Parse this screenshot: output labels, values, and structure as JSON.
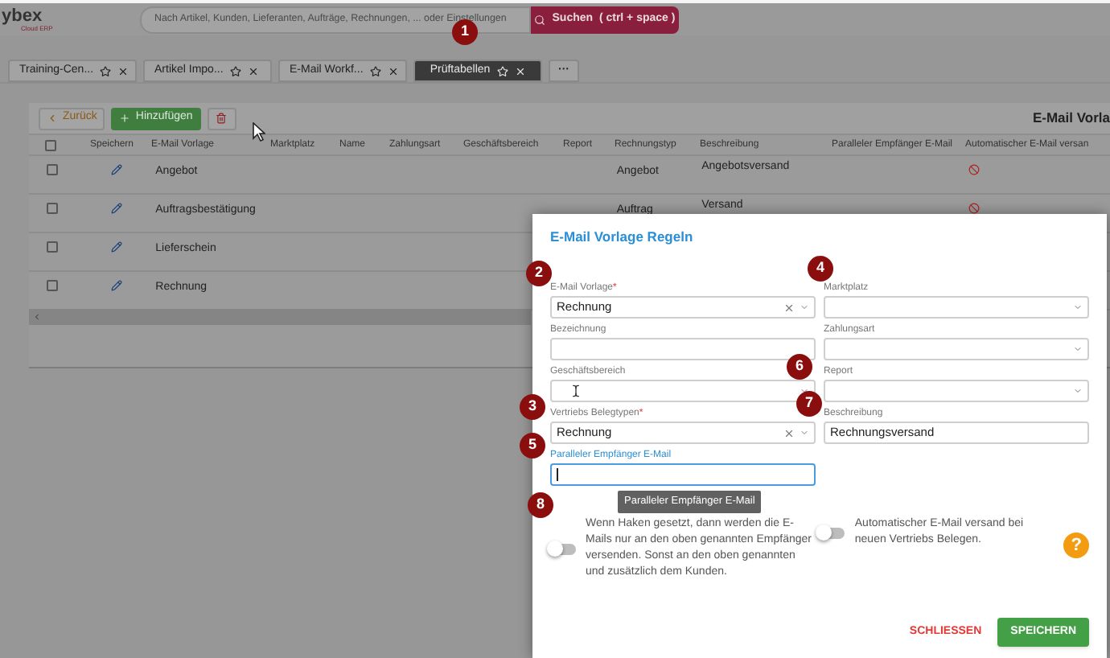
{
  "header": {
    "logo": "ybex",
    "logo_sub": "Cloud ERP",
    "search": {
      "placeholder": "Nach Artikel, Kunden, Lieferanten, Aufträge, Rechnungen, ... oder Einstellungen"
    },
    "search_button": "Suchen  ( ctrl + space )"
  },
  "tabs": [
    {
      "kind": "tab",
      "label": "Training-Cen...",
      "selected": false
    },
    {
      "kind": "tab",
      "label": "Artikel Impo...",
      "selected": false
    },
    {
      "kind": "tab",
      "label": "E-Mail Workf...",
      "selected": false
    },
    {
      "kind": "tab",
      "label": "Prüftabellen",
      "selected": true
    },
    {
      "kind": "more",
      "label": "···",
      "selected": false
    }
  ],
  "toolbar": {
    "back": "Zurück",
    "add": "Hinzufügen",
    "title": "E-Mail Vorla"
  },
  "table": {
    "header_checked": false,
    "columns": [
      "Speichern",
      "E-Mail Vorlage",
      "Marktplatz",
      "Name",
      "Zahlungsart",
      "Geschäftsbereich",
      "Report",
      "Rechnungstyp",
      "Beschreibung",
      "Paralleler Empfänger E-Mail",
      "Automatischer E-Mail versan"
    ],
    "rows": [
      {
        "checked": false,
        "vorlage": "Angebot",
        "rechnungstyp": "Angebot",
        "beschreibung": "Angebotsversand",
        "auto_send": false
      },
      {
        "checked": false,
        "vorlage": "Auftragsbestätigung",
        "rechnungstyp": "Auftrag",
        "beschreibung": "Versand",
        "auto_send": false
      },
      {
        "checked": false,
        "vorlage": "Lieferschein"
      },
      {
        "checked": false,
        "vorlage": "Rechnung"
      }
    ]
  },
  "dialog": {
    "title": "E-Mail Vorlage Regeln",
    "fields": [
      {
        "label": "E-Mail Vorlage",
        "required_mark": "*",
        "kind": "select",
        "value": "Rechnung",
        "clearable": true
      },
      {
        "label": "Marktplatz",
        "kind": "select",
        "clearable": false
      },
      {
        "label": "Bezeichnung",
        "kind": "text",
        "clearable": false
      },
      {
        "label": "Zahlungsart",
        "kind": "select",
        "clearable": false
      },
      {
        "label": "Geschäftsbereich",
        "kind": "select",
        "clearable": false
      },
      {
        "label": "Report",
        "kind": "select",
        "clearable": false
      },
      {
        "label": "Vertriebs Belegtypen",
        "required_mark": "*",
        "kind": "select",
        "value": "Rechnung",
        "clearable": true
      },
      {
        "label": "Beschreibung",
        "kind": "text",
        "value": "Rechnungsversand",
        "clearable": false
      }
    ],
    "parallel": {
      "label": "Paralleler Empfänger E-Mail",
      "focused": true
    },
    "tooltip": "Paralleler Empfänger E-Mail",
    "toggles": [
      {
        "label": "Wenn Haken gesetzt, dann werden die E-Mails nur an den oben genannten Empfänger versenden. Sonst an den oben genannten und zusätzlich dem Kunden.",
        "on": false
      },
      {
        "label": "Automatischer E-Mail versand bei neuen Vertriebs Belegen.",
        "on": false
      }
    ],
    "help": "?",
    "buttons": {
      "close": "SCHLIESSEN",
      "save": "SPEICHERN"
    }
  },
  "badges": [
    "1",
    "2",
    "4",
    "6",
    "3",
    "7",
    "5",
    "8"
  ]
}
